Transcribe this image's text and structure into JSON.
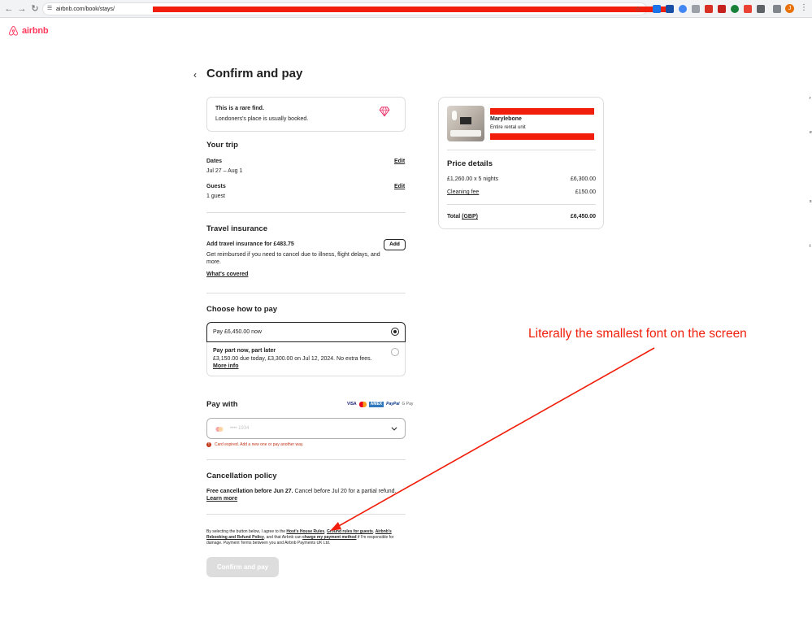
{
  "browser": {
    "url": "airbnb.com/book/stays/",
    "profile_initial": "J"
  },
  "header": {
    "logo_text": "airbnb"
  },
  "page": {
    "title": "Confirm and pay"
  },
  "rare_find": {
    "title": "This is a rare find.",
    "subtitle": "Londoners's place is usually booked."
  },
  "trip": {
    "heading": "Your trip",
    "dates_label": "Dates",
    "dates_value": "Jul 27 – Aug 1",
    "guests_label": "Guests",
    "guests_value": "1 guest",
    "edit_label": "Edit"
  },
  "insurance": {
    "heading": "Travel insurance",
    "title": "Add travel insurance for £483.75",
    "description": "Get reimbursed if you need to cancel due to illness, flight delays, and more.",
    "add_label": "Add",
    "covered_link": "What's covered"
  },
  "payment_choice": {
    "heading": "Choose how to pay",
    "option_full": "Pay £6,450.00 now",
    "option_part_title": "Pay part now, part later",
    "option_part_desc": "£3,150.00 due today, £3,300.00 on Jul 12, 2024. No extra fees.",
    "more_info": "More info"
  },
  "pay_with": {
    "heading": "Pay with",
    "card_brands": [
      "VISA",
      "MC",
      "AMEX",
      "PayPal",
      "G Pay"
    ],
    "card_number": "•••• 1934",
    "error": "Card expired. Add a new one or pay another way."
  },
  "cancellation": {
    "heading": "Cancellation policy",
    "bold": "Free cancellation before Jun 27.",
    "text": " Cancel before Jul 20 for a partial refund.",
    "learn_more": "Learn more"
  },
  "legal": {
    "p1": "By selecting the button below, I agree to the ",
    "host_rules": "Host's House Rules",
    "sep1": ", ",
    "ground_rules": "Ground rules for guests",
    "sep2": ", ",
    "rebooking": "Airbnb's Rebooking and Refund Policy",
    "p2": ", and that Airbnb can ",
    "charge": "charge my payment method",
    "p3": " if I'm responsible for damage. Payment Terms between you and Airbnb Payments UK Ltd."
  },
  "confirm_button": "Confirm and pay",
  "listing": {
    "name": "Marylebone",
    "type": "Entire rental unit"
  },
  "price_details": {
    "heading": "Price details",
    "nightly_label": "£1,260.00 x 5 nights",
    "nightly_value": "£6,300.00",
    "cleaning_label": "Cleaning fee",
    "cleaning_value": "£150.00",
    "total_label": "Total",
    "total_currency": "(GBP)",
    "total_value": "£6,450.00"
  },
  "annotation": {
    "text": "Literally the smallest font on the screen"
  },
  "colors": {
    "brand": "#ff385c",
    "annotation": "#f01e0a",
    "error": "#c13515"
  }
}
